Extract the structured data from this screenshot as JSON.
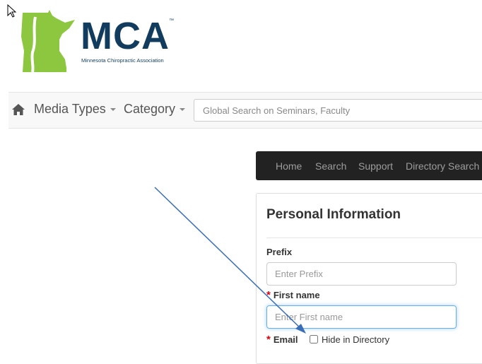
{
  "logo": {
    "text": "MCA",
    "tm": "™",
    "subtitle": "Minnesota Chiropractic Association",
    "colors": {
      "state_shape": "#8dc63f",
      "text": "#123c5e"
    }
  },
  "navbar": {
    "home_icon": "home-icon",
    "media_types": "Media Types",
    "category": "Category",
    "search_placeholder": "Global Search on Seminars, Faculty"
  },
  "top_menu": {
    "items": [
      "Home",
      "Search",
      "Support",
      "Directory Search"
    ]
  },
  "form": {
    "title": "Personal Information",
    "prefix_label": "Prefix",
    "prefix_placeholder": "Enter Prefix",
    "first_name_label": "First name",
    "first_name_placeholder": "Enter First name",
    "email_label": "Email",
    "hide_label": "Hide in Directory",
    "required_mark": "*"
  },
  "annotation": {
    "color": "#3a6fb8"
  }
}
